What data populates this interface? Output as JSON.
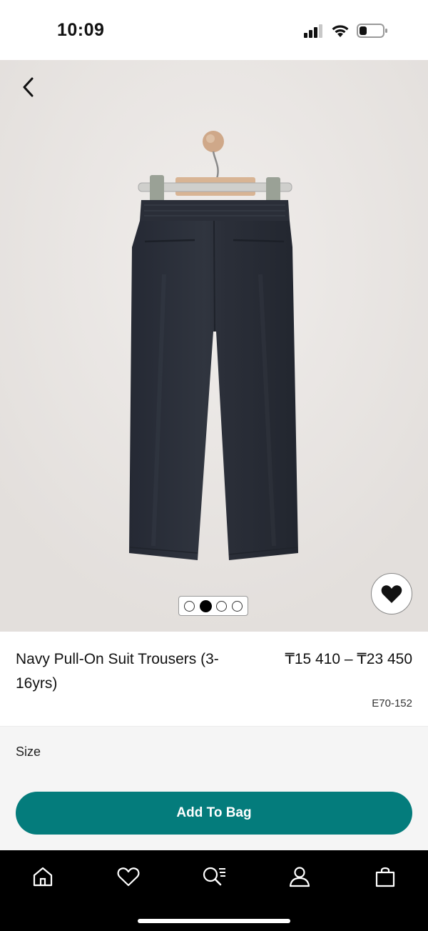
{
  "status_bar": {
    "time": "10:09",
    "icons": [
      "cellular-signal-icon",
      "wifi-icon",
      "battery-icon"
    ]
  },
  "hero": {
    "image": "navy-pull-on-suit-trousers-on-hanger",
    "pager": {
      "count": 4,
      "active_index": 1
    },
    "icons": {
      "back": "chevron-left-icon",
      "favorite": "heart-icon"
    }
  },
  "product": {
    "title": "Navy Pull-On Suit Trousers (3-16yrs)",
    "price": "₸15 410 – ₸23 450",
    "sku": "E70-152"
  },
  "size": {
    "label": "Size"
  },
  "cta": {
    "add_to_bag": "Add To Bag"
  },
  "tab_bar": {
    "items": [
      "home-icon",
      "heart-icon",
      "search-list-icon",
      "user-icon",
      "bag-icon"
    ]
  },
  "colors": {
    "accent": "#047c7c",
    "tab_bar_bg": "#000000",
    "trousers": "#2b2f3a",
    "hero_bg": "#ece8e6"
  }
}
